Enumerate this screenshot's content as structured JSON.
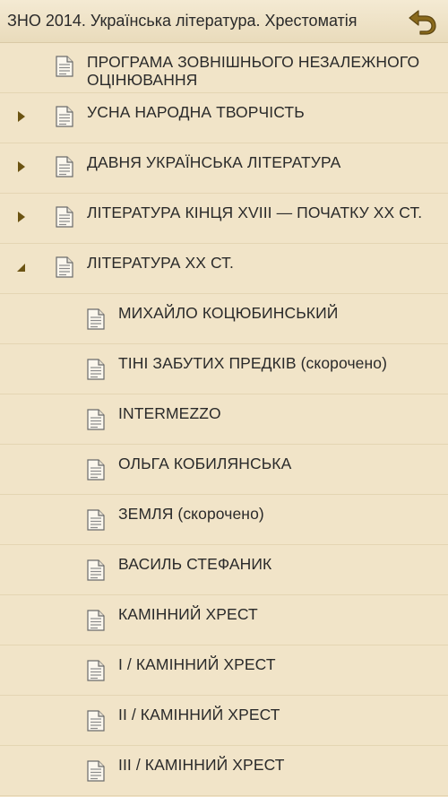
{
  "header": {
    "title": "ЗНО 2014. Українська література. Хрестоматія",
    "back_icon": "undo-arrow-icon"
  },
  "colors": {
    "background": "#f1e4c8",
    "icon_accent": "#8a6a1c",
    "text": "#2a2a2a"
  },
  "tree": [
    {
      "label": "ПРОГРАМА ЗОВНІШНЬОГО НЕЗАЛЕЖНОГО ОЦІНЮВАННЯ",
      "level": 0,
      "expander": "none"
    },
    {
      "label": "УСНА НАРОДНА ТВОРЧІСТЬ",
      "level": 0,
      "expander": "collapsed"
    },
    {
      "label": "ДАВНЯ УКРАЇНСЬКА ЛІТЕРАТУРА",
      "level": 0,
      "expander": "collapsed"
    },
    {
      "label": "ЛІТЕРАТУРА КІНЦЯ XVIII — ПОЧАТКУ XX СТ.",
      "level": 0,
      "expander": "collapsed"
    },
    {
      "label": "ЛІТЕРАТУРА XX СТ.",
      "level": 0,
      "expander": "expanded"
    },
    {
      "label": "МИХАЙЛО КОЦЮБИНСЬКИЙ",
      "level": 1,
      "expander": "none"
    },
    {
      "label": "ТІНІ ЗАБУТИХ ПРЕДКІВ (скорочено)",
      "level": 1,
      "expander": "none"
    },
    {
      "label": "INTERMEZZO",
      "level": 1,
      "expander": "none"
    },
    {
      "label": "ОЛЬГА КОБИЛЯНСЬКА",
      "level": 1,
      "expander": "none"
    },
    {
      "label": "ЗЕМЛЯ (скорочено)",
      "level": 1,
      "expander": "none"
    },
    {
      "label": "ВАСИЛЬ СТЕФАНИК",
      "level": 1,
      "expander": "none"
    },
    {
      "label": "КАМІННИЙ ХРЕСТ",
      "level": 1,
      "expander": "none"
    },
    {
      "label": "I / КАМІННИЙ ХРЕСТ",
      "level": 1,
      "expander": "none"
    },
    {
      "label": "II / КАМІННИЙ ХРЕСТ",
      "level": 1,
      "expander": "none"
    },
    {
      "label": "III / КАМІННИЙ ХРЕСТ",
      "level": 1,
      "expander": "none"
    }
  ]
}
